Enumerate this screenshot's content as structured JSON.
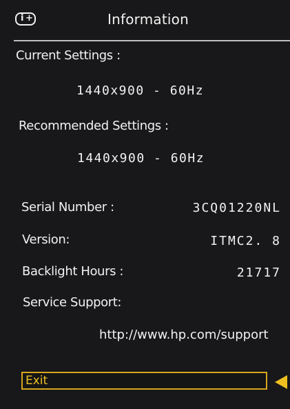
{
  "header": {
    "icon": "information-plus-icon",
    "icon_letter": "i",
    "icon_plus": "+",
    "title": "Information"
  },
  "current_settings": {
    "label": "Current Settings :",
    "value": "1440x900 - 60Hz"
  },
  "recommended_settings": {
    "label": "Recommended Settings :",
    "value": "1440x900 - 60Hz"
  },
  "details": [
    {
      "label": "Serial Number :",
      "value": "3CQ01220NL"
    },
    {
      "label": "Version:",
      "value": "ITMC2. 8"
    },
    {
      "label": "Backlight Hours :",
      "value": "21717"
    }
  ],
  "service_support": {
    "label": "Service Support:",
    "url": "http://www.hp.com/support"
  },
  "exit": {
    "label": "Exit",
    "icon": "left-arrow-icon"
  },
  "colors": {
    "background": "#18181a",
    "text": "#f2f2f2",
    "accent": "#f0c020",
    "rule": "#bfbfbf"
  }
}
